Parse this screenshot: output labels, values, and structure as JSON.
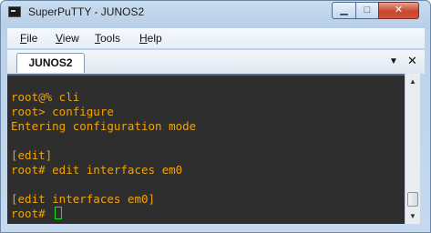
{
  "window": {
    "title": "SuperPuTTY - JUNOS2"
  },
  "menu": {
    "items": [
      {
        "key": "F",
        "rest": "ile"
      },
      {
        "key": "V",
        "rest": "iew"
      },
      {
        "key": "T",
        "rest": "ools"
      },
      {
        "key": "H",
        "rest": "elp"
      }
    ]
  },
  "tabs": [
    {
      "label": "JUNOS2"
    }
  ],
  "icons": {
    "minimize": "minimize-icon",
    "maximize": "maximize-icon",
    "close": "close-icon",
    "tab_menu": "chevron-down-icon",
    "tab_close": "close-icon"
  },
  "terminal": {
    "text_color": "#f0a30a",
    "background": "#2e2e2e",
    "cursor_color": "#19e619",
    "lines": [
      "root@% cli",
      "root> configure",
      "Entering configuration mode",
      "",
      "[edit]",
      "root# edit interfaces em0",
      "",
      "[edit interfaces em0]",
      "root# "
    ]
  }
}
